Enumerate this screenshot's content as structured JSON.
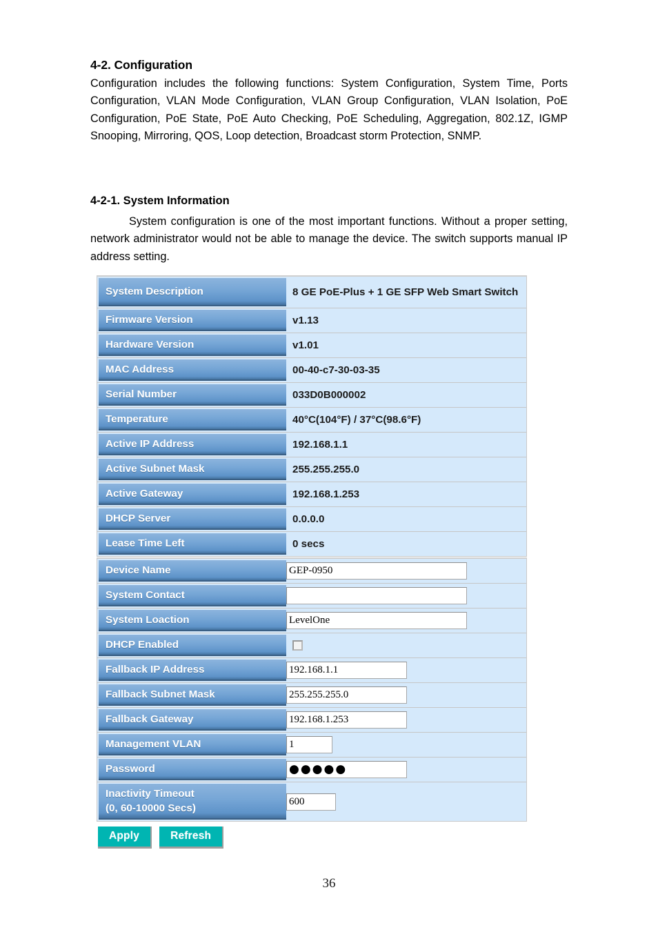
{
  "document": {
    "section": {
      "heading": "4-2. Configuration",
      "body": "Configuration includes the following functions: System Configuration, System Time, Ports Configuration, VLAN Mode Configuration, VLAN Group Configuration, VLAN Isolation, PoE Configuration, PoE State, PoE Auto Checking, PoE Scheduling, Aggregation, 802.1Z, IGMP Snooping, Mirroring, QOS, Loop detection, Broadcast storm Protection, SNMP."
    },
    "subsection": {
      "heading": "4-2-1. System Information",
      "body": "System configuration is one of the most important functions. Without a proper setting, network administrator would not be able to manage the device. The switch supports manual IP address setting."
    },
    "page_number": "36"
  },
  "system_information": {
    "rows": [
      {
        "label": "System Description",
        "value": "8 GE PoE-Plus + 1 GE SFP Web Smart Switch"
      },
      {
        "label": "Firmware Version",
        "value": "v1.13"
      },
      {
        "label": "Hardware Version",
        "value": "v1.01"
      },
      {
        "label": "MAC Address",
        "value": "00-40-c7-30-03-35"
      },
      {
        "label": "Serial Number",
        "value": "033D0B000002"
      },
      {
        "label": "Temperature",
        "value": "40°C(104°F) / 37°C(98.6°F)"
      },
      {
        "label": "Active IP Address",
        "value": "192.168.1.1"
      },
      {
        "label": "Active Subnet Mask",
        "value": "255.255.255.0"
      },
      {
        "label": "Active Gateway",
        "value": "192.168.1.253"
      },
      {
        "label": "DHCP Server",
        "value": "0.0.0.0"
      },
      {
        "label": "Lease Time Left",
        "value": "0 secs"
      }
    ]
  },
  "system_configuration": {
    "rows": [
      {
        "label": "Device Name",
        "value": "GEP-0950",
        "type": "text",
        "width": "wide"
      },
      {
        "label": "System Contact",
        "value": "",
        "type": "text",
        "width": "wide"
      },
      {
        "label": "System Loaction",
        "value": "LevelOne",
        "type": "text",
        "width": "wide"
      },
      {
        "label": "DHCP Enabled",
        "value": "",
        "type": "checkbox",
        "checked": false
      },
      {
        "label": "Fallback IP Address",
        "value": "192.168.1.1",
        "type": "text",
        "width": "med"
      },
      {
        "label": "Fallback Subnet Mask",
        "value": "255.255.255.0",
        "type": "text",
        "width": "med"
      },
      {
        "label": "Fallback Gateway",
        "value": "192.168.1.253",
        "type": "text",
        "width": "med"
      },
      {
        "label": "Management VLAN",
        "value": "1",
        "type": "text",
        "width": "narrow"
      },
      {
        "label": "Password",
        "value": "●●●●●",
        "type": "password",
        "width": "med"
      },
      {
        "label": "Inactivity Timeout",
        "label_line2": "(0, 60-10000 Secs)",
        "value": "600",
        "type": "text",
        "width": "small"
      }
    ],
    "buttons": {
      "apply": "Apply",
      "refresh": "Refresh"
    }
  },
  "colors": {
    "label_gradient_top": "#8cb4dd",
    "label_gradient_bottom": "#44729f",
    "value_background": "#d5e9fb",
    "button_teal": "#00b5b2",
    "table_border": "#c6c6c6"
  }
}
